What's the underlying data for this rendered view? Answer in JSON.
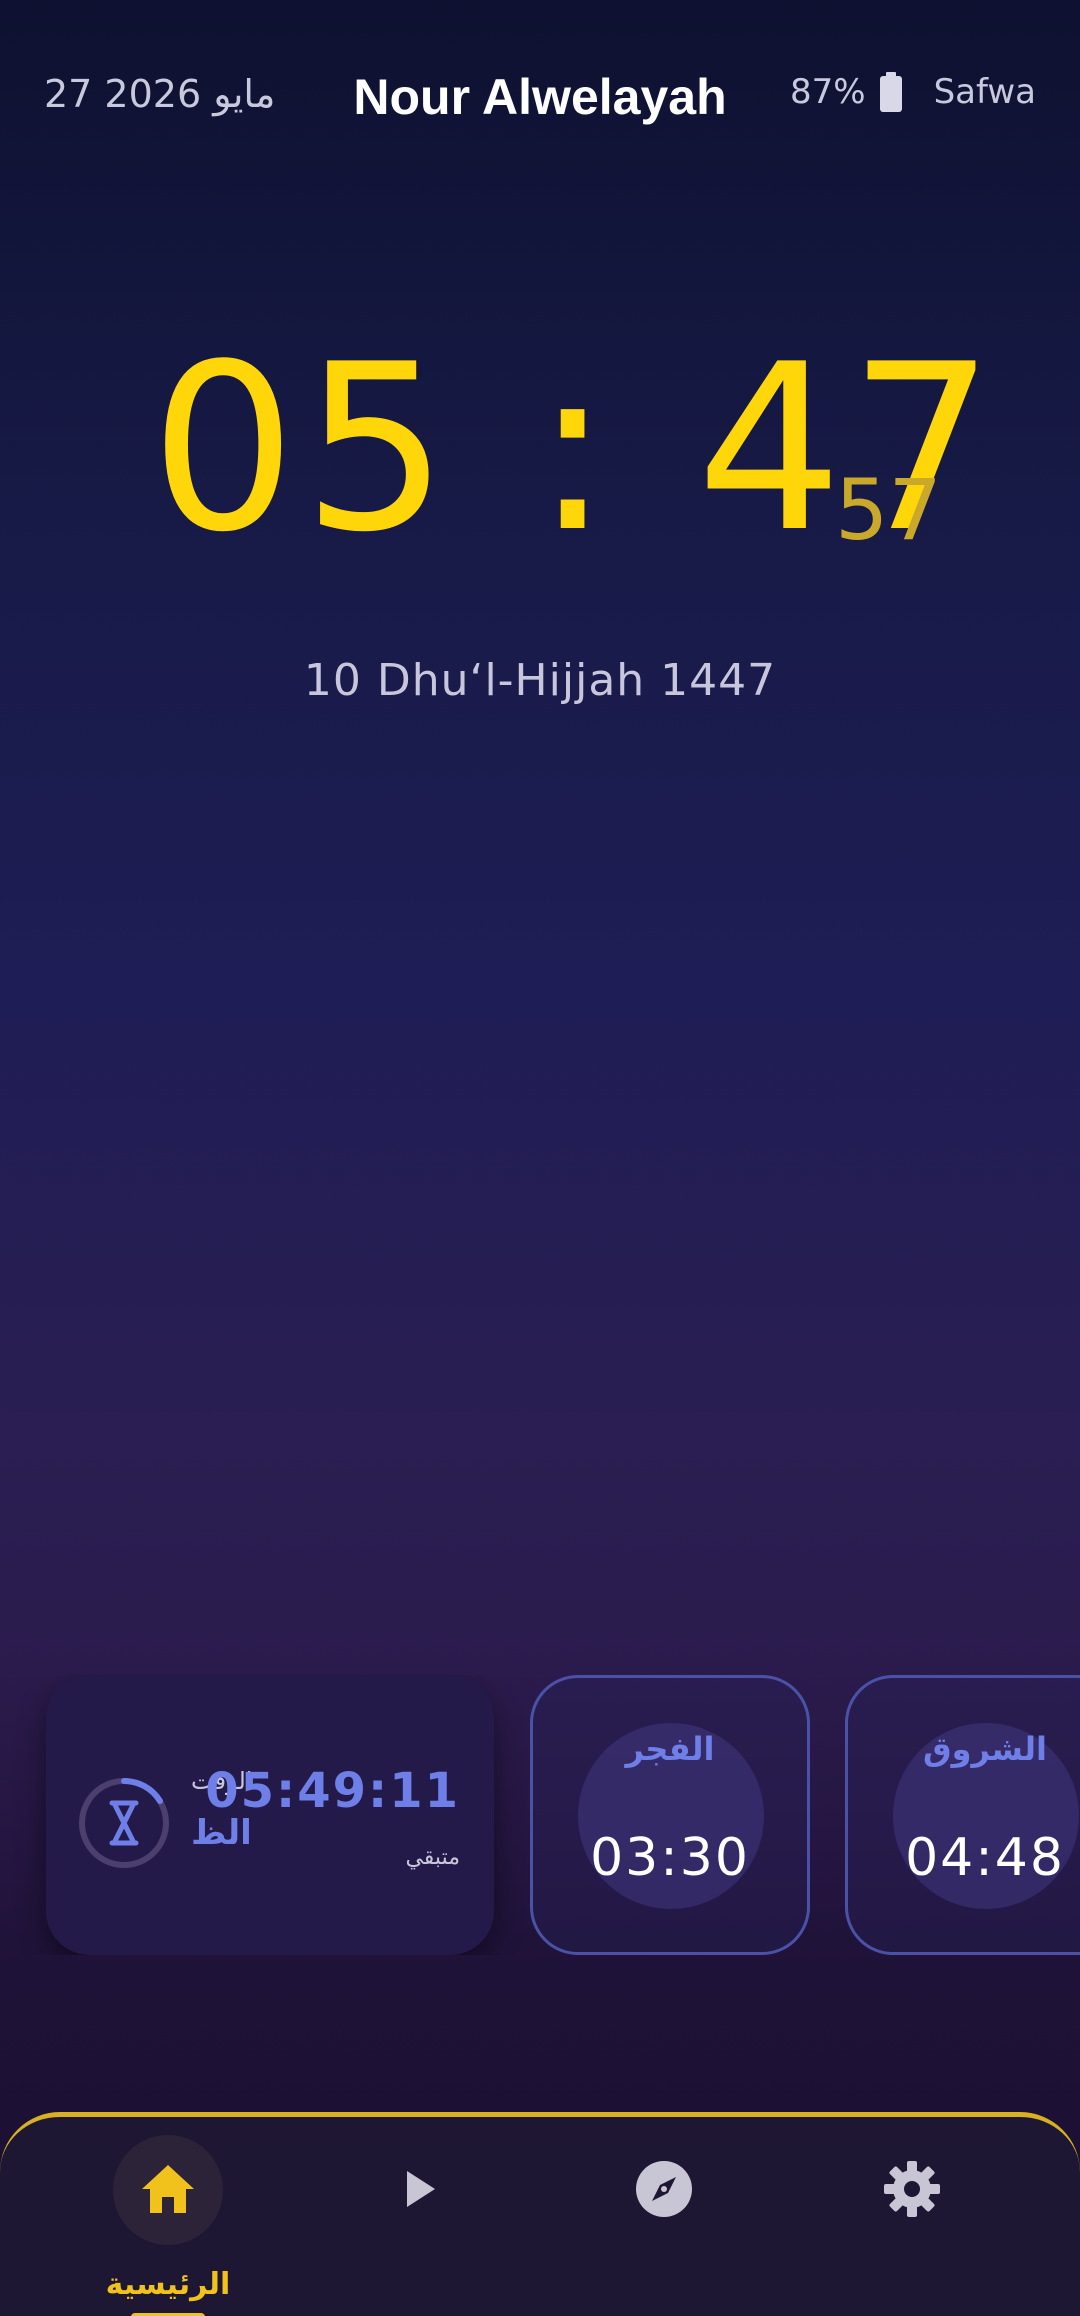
{
  "status": {
    "date": "27 2026 مايو",
    "title": "Nour Alwelayah",
    "battery": "87%",
    "network": "Safwa"
  },
  "clock": {
    "hours_minutes": "05 : 47",
    "seconds": "57",
    "hijri_date": "10 Dhuʻl-Hijjah 1447"
  },
  "countdown": {
    "time": "05:49:11",
    "label_top": "الوقت",
    "prayer": "الظ",
    "remaining": "متبقي",
    "icon": "hourglass-icon"
  },
  "prayers": [
    {
      "name": "الفجر",
      "time": "03:30"
    },
    {
      "name": "الشروق",
      "time": "04:48"
    }
  ],
  "nav": {
    "home_label": "الرئيسية",
    "icons": [
      "home-icon",
      "play-icon",
      "compass-icon",
      "gear-icon"
    ]
  },
  "colors": {
    "accent_gold": "#ffd60a",
    "accent_blue": "#6f7fe8",
    "nav_active": "#f2c21c"
  }
}
